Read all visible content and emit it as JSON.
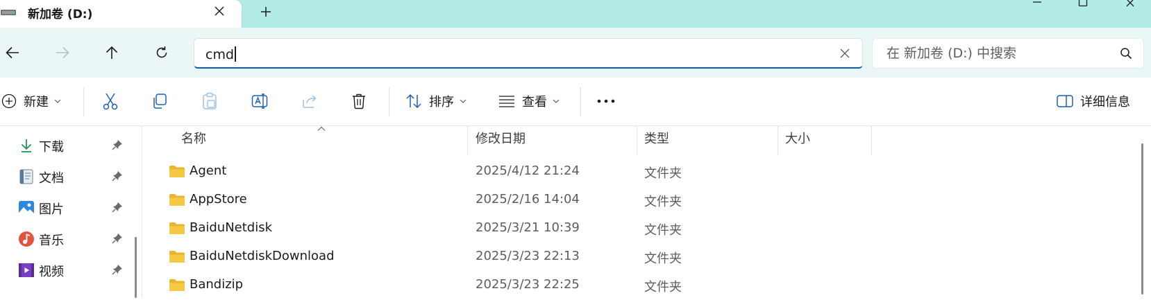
{
  "tab": {
    "title": "新加卷 (D:)",
    "icon": "drive-icon"
  },
  "toolbar": {
    "new_label": "新建",
    "sort_label": "排序",
    "view_label": "查看",
    "details_label": "详细信息"
  },
  "address": {
    "value": "cmd"
  },
  "search": {
    "placeholder": "在 新加卷 (D:) 中搜索"
  },
  "sidebar": {
    "items": [
      {
        "label": "下载",
        "icon": "download-icon",
        "pinned": true
      },
      {
        "label": "文档",
        "icon": "document-icon",
        "pinned": true
      },
      {
        "label": "图片",
        "icon": "pictures-icon",
        "pinned": true
      },
      {
        "label": "音乐",
        "icon": "music-icon",
        "pinned": true
      },
      {
        "label": "视频",
        "icon": "video-icon",
        "pinned": true
      }
    ]
  },
  "columns": {
    "name": "名称",
    "date": "修改日期",
    "type": "类型",
    "size": "大小"
  },
  "files": [
    {
      "name": "Agent",
      "date": "2025/4/12 21:24",
      "type": "文件夹",
      "size": ""
    },
    {
      "name": "AppStore",
      "date": "2025/2/16 14:04",
      "type": "文件夹",
      "size": ""
    },
    {
      "name": "BaiduNetdisk",
      "date": "2025/3/21 10:39",
      "type": "文件夹",
      "size": ""
    },
    {
      "name": "BaiduNetdiskDownload",
      "date": "2025/3/23 22:13",
      "type": "文件夹",
      "size": ""
    },
    {
      "name": "Bandizip",
      "date": "2025/3/23 22:25",
      "type": "文件夹",
      "size": ""
    }
  ],
  "colors": {
    "titlebar": "#b3ebe7",
    "navrow": "#eaf7f6",
    "accent": "#005fb8",
    "folder": "#f6c945"
  }
}
